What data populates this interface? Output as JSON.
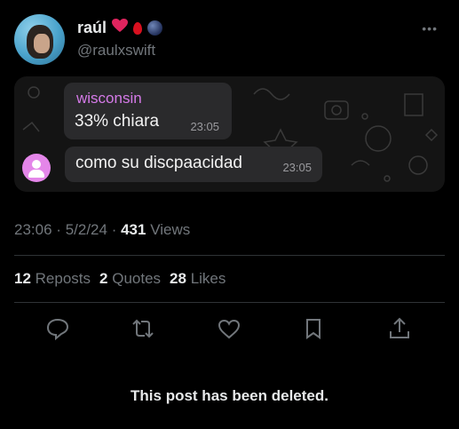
{
  "author": {
    "name": "raúl",
    "handle": "@raulxswift",
    "badges": [
      "heart-emoji",
      "blood-drop-emoji",
      "planet-emoji"
    ]
  },
  "more_label": "•••",
  "chat": {
    "messages": [
      {
        "sender": "wisconsin",
        "text": "33% chiara",
        "time": "23:05"
      },
      {
        "text": "como su discpaacidad",
        "time": "23:05"
      }
    ]
  },
  "meta": {
    "time": "23:06",
    "separator": "·",
    "date": "5/2/24",
    "views_count": "431",
    "views_label": "Views"
  },
  "stats": {
    "reposts_count": "12",
    "reposts_label": "Reposts",
    "quotes_count": "2",
    "quotes_label": "Quotes",
    "likes_count": "28",
    "likes_label": "Likes"
  },
  "actions": [
    "reply-icon",
    "repost-icon",
    "like-icon",
    "bookmark-icon",
    "share-icon"
  ],
  "notice": "This post has been deleted.",
  "colors": {
    "background": "#000000",
    "text_primary": "#e7e9ea",
    "text_secondary": "#71767b",
    "bubble": "#2a2a2c",
    "sender_name": "#d57ae8",
    "heart": "#e0245e"
  }
}
